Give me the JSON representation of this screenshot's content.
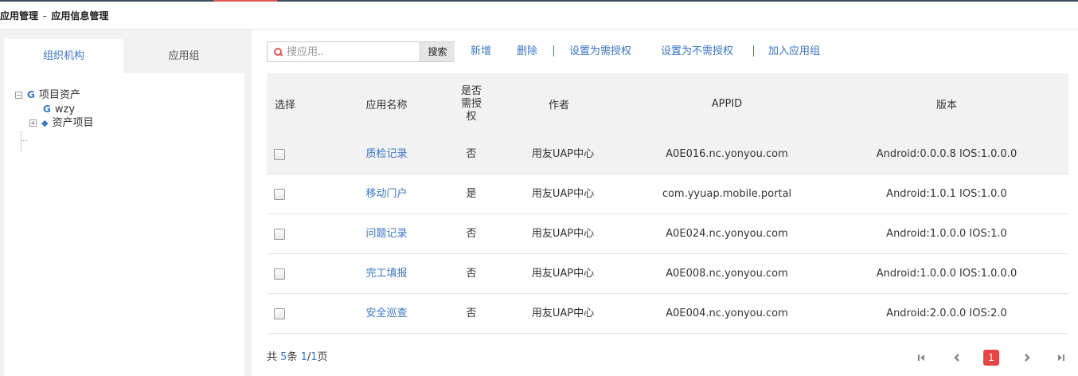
{
  "breadcrumb": {
    "parent": "应用管理",
    "separator": "-",
    "current": "应用信息管理"
  },
  "left_tabs": [
    "组织机构",
    "应用组"
  ],
  "tree": {
    "root": "项目资产",
    "children": [
      "wzy",
      "资产项目"
    ]
  },
  "search": {
    "placeholder": "搜应用..",
    "value": "",
    "button": "搜索"
  },
  "toolbar": {
    "add": "新增",
    "delete": "删除",
    "require_auth": "设置为需授权",
    "no_auth": "设置为不需授权",
    "add_to_group": "加入应用组"
  },
  "table": {
    "headers": {
      "select": "选择",
      "name": "应用名称",
      "auth_line1": "是否",
      "auth_line2": "需授",
      "auth_line3": "权",
      "author": "作者",
      "appid": "APPID",
      "version": "版本"
    },
    "rows": [
      {
        "name": "质检记录",
        "auth": "否",
        "author": "用友UAP中心",
        "appid": "A0E016.nc.yonyou.com",
        "version": "Android:0.0.0.8 IOS:1.0.0.0"
      },
      {
        "name": "移动门户",
        "auth": "是",
        "author": "用友UAP中心",
        "appid": "com.yyuap.mobile.portal",
        "version": "Android:1.0.1 IOS:1.0.0"
      },
      {
        "name": "问题记录",
        "auth": "否",
        "author": "用友UAP中心",
        "appid": "A0E024.nc.yonyou.com",
        "version": "Android:1.0.0.0 IOS:1.0"
      },
      {
        "name": "完工填报",
        "auth": "否",
        "author": "用友UAP中心",
        "appid": "A0E008.nc.yonyou.com",
        "version": "Android:1.0.0.0 IOS:1.0.0.0"
      },
      {
        "name": "安全巡查",
        "auth": "否",
        "author": "用友UAP中心",
        "appid": "A0E004.nc.yonyou.com",
        "version": "Android:2.0.0.0 IOS:2.0"
      }
    ]
  },
  "footer": {
    "total_prefix": "共",
    "total": "5",
    "unit": "条",
    "current_page": "1",
    "slash": "/",
    "total_pages": "1",
    "page_suffix": "页"
  },
  "pager": {
    "current": "1"
  },
  "colors": {
    "accent": "#3a75c4",
    "highlight": "#e54545"
  },
  "icons": [
    "search-icon",
    "first-page-icon",
    "prev-page-icon",
    "next-page-icon",
    "last-page-icon",
    "tree-node-icon",
    "diamond-icon",
    "expand-icon"
  ]
}
